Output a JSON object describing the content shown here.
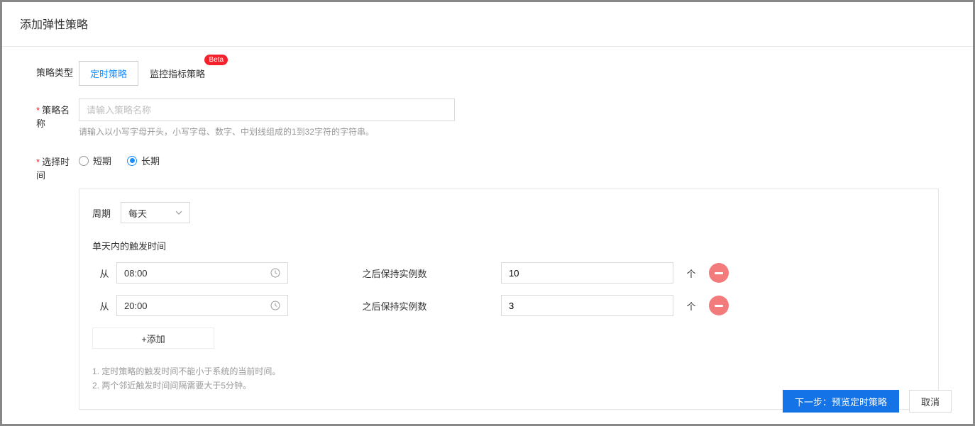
{
  "dialog": {
    "title": "添加弹性策略"
  },
  "form": {
    "policy_type_label": "策略类型",
    "policy_name_label": "策略名称",
    "policy_name_placeholder": "请输入策略名称",
    "policy_name_hint": "请输入以小写字母开头，小写字母、数字、中划线组成的1到32字符的字符串。",
    "select_time_label": "选择时间"
  },
  "tabs": {
    "timed": "定时策略",
    "metric": "监控指标策略",
    "beta_badge": "Beta"
  },
  "radios": {
    "short": "短期",
    "long": "长期"
  },
  "config": {
    "cycle_label": "周期",
    "cycle_value": "每天",
    "subtitle": "单天内的触发时间",
    "from_label": "从",
    "keep_label": "之后保持实例数",
    "unit": "个",
    "add_label": "+添加",
    "rows": [
      {
        "time": "08:00",
        "count": "10"
      },
      {
        "time": "20:00",
        "count": "3"
      }
    ],
    "notes": {
      "n1": "1. 定时策略的触发时间不能小于系统的当前时间。",
      "n2": "2. 两个邻近触发时间间隔需要大于5分钟。"
    }
  },
  "footer": {
    "next": "下一步：预览定时策略",
    "cancel": "取消"
  }
}
